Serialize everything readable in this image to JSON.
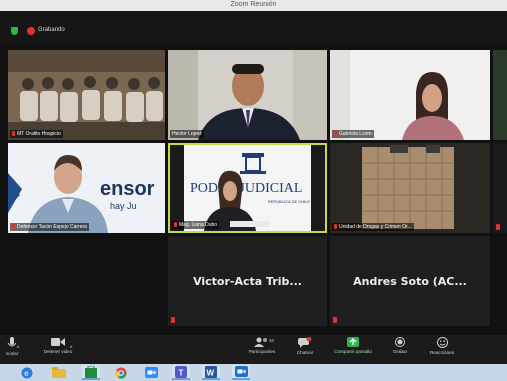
{
  "window": {
    "title": "Zoom Reunión"
  },
  "meeting": {
    "recording_label": "Grabando"
  },
  "participants": [
    {
      "name": "MT Oralito Hospicio"
    },
    {
      "name": "Hector Lopez"
    },
    {
      "name": "Gabriela Lcom"
    },
    {
      "name": "Defensor Tacón Espejo Carrera"
    },
    {
      "name": "Mag. Liana Dubo"
    },
    {
      "name": "Unidad de Drogas y Crimen Or..."
    },
    {
      "name": "Victor-Acta Trib..."
    },
    {
      "name": "Andres Soto (AC..."
    }
  ],
  "backdrops": {
    "sensor_text": "ensor",
    "sensor_sub": "hay Ju",
    "judiciary_text": "PODER JUDICIAL",
    "judiciary_sub": "REPÚBLICA DE CHILE"
  },
  "toolbar": {
    "mute_label": "ncelar",
    "video_label": "Detener video",
    "participants_label": "Participantes",
    "participants_count": "10",
    "chat_label": "Chatear",
    "share_label": "Compartir pantalla",
    "record_label": "Grabar",
    "reactions_label": "Reacciones"
  },
  "colors": {
    "recording_red": "#e0322f",
    "share_green": "#2fb34a",
    "active_speaker_border": "#c9d94a",
    "taskbar": "#c8d7e8"
  },
  "taskbar_apps": [
    "edge-icon",
    "file-explorer-icon",
    "store-icon",
    "chrome-icon",
    "zoom-icon",
    "teams-icon",
    "word-icon",
    "zoom-meeting-icon"
  ]
}
